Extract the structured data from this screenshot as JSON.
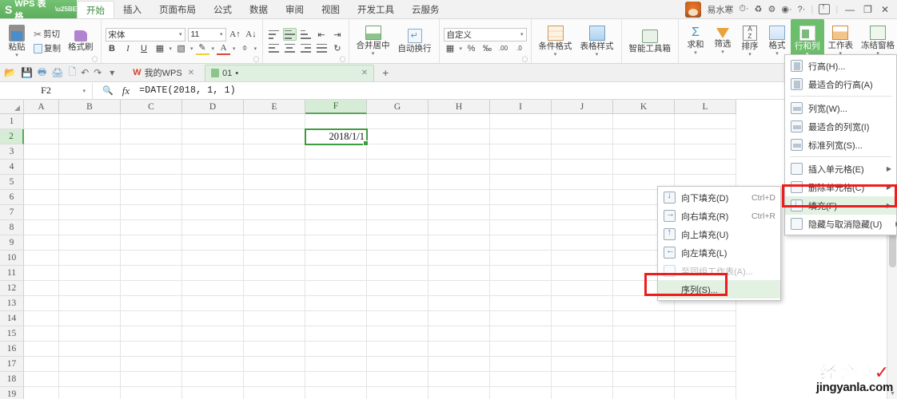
{
  "titlebar": {
    "app_name": "WPS 表格",
    "logo_glyph": "S",
    "tabs": [
      {
        "label": "开始",
        "active": true
      },
      {
        "label": "插入",
        "active": false
      },
      {
        "label": "页面布局",
        "active": false
      },
      {
        "label": "公式",
        "active": false
      },
      {
        "label": "数据",
        "active": false
      },
      {
        "label": "审阅",
        "active": false
      },
      {
        "label": "视图",
        "active": false
      },
      {
        "label": "开发工具",
        "active": false
      },
      {
        "label": "云服务",
        "active": false
      }
    ],
    "user_name": "易水寒",
    "right_icons": [
      "clock-icon",
      "sync-icon",
      "settings-icon",
      "dollar-icon",
      "help-icon",
      "share-box-icon"
    ],
    "minimize": "—",
    "restore": "❐",
    "close": "✕"
  },
  "ribbon": {
    "clipboard": {
      "paste": "粘贴",
      "cut": "剪切",
      "copy": "复制",
      "format_painter": "格式刷"
    },
    "font": {
      "family_value": "宋体",
      "size_value": "11",
      "grow": "A",
      "shrink": "A",
      "bold": "B",
      "italic": "I",
      "underline": "U"
    },
    "alignment": {
      "merge_center": "合并居中",
      "wrap_text": "自动换行"
    },
    "number": {
      "format_value": "自定义",
      "percent": "%",
      "comma": "‰",
      "inc_dec": ".00",
      "dec_dec": ".0"
    },
    "styles": {
      "conditional_format": "条件格式",
      "table_style": "表格样式",
      "smart_toolbox": "智能工具箱"
    },
    "editing": {
      "autosum": "求和",
      "filter": "筛选",
      "sort": "排序",
      "format": "格式",
      "rows_cols": "行和列",
      "worksheet": "工作表",
      "freeze_panes": "冻结窗格"
    }
  },
  "quickbar": {
    "icons": [
      "open-icon",
      "save-icon",
      "print-preview-icon",
      "print-icon",
      "export-pdf-icon",
      "undo-icon",
      "redo-icon",
      "customize-caret-icon"
    ],
    "doc_tabs": [
      {
        "label": "我的WPS",
        "active": false,
        "badge": "W"
      },
      {
        "label": "01",
        "active": true,
        "badge": "doc"
      }
    ],
    "dirty_marker": "•",
    "new_tab": "+"
  },
  "formula_bar": {
    "name_box_value": "F2",
    "search_icon": "search-icon",
    "fx_icon": "fx",
    "formula_value": "=DATE(2018, 1, 1)"
  },
  "sheet": {
    "columns": [
      "A",
      "B",
      "C",
      "D",
      "E",
      "F",
      "G",
      "H",
      "I",
      "J",
      "K",
      "L"
    ],
    "selected_column": "F",
    "rows": [
      "1",
      "2",
      "3",
      "4",
      "5",
      "6",
      "7",
      "8",
      "9",
      "10",
      "11",
      "12",
      "13",
      "14",
      "15",
      "16",
      "17",
      "18",
      "19"
    ],
    "selected_row": "2",
    "selected_cell": "F2",
    "selected_cell_value": "2018/1/1"
  },
  "rows_cols_menu": {
    "items": [
      {
        "label": "行高(H)...",
        "icon": "row-height-icon",
        "arrow": false,
        "selected": false,
        "disabled": false
      },
      {
        "label": "最适合的行高(A)",
        "icon": "best-fit-row-icon",
        "arrow": false,
        "selected": false,
        "disabled": false
      },
      {
        "label": "列宽(W)...",
        "icon": "col-width-icon",
        "arrow": false,
        "selected": false,
        "disabled": false
      },
      {
        "label": "最适合的列宽(I)",
        "icon": "best-fit-col-icon",
        "arrow": false,
        "selected": false,
        "disabled": false
      },
      {
        "label": "标准列宽(S)...",
        "icon": "standard-col-width-icon",
        "arrow": false,
        "selected": false,
        "disabled": false
      },
      {
        "label": "插入单元格(E)",
        "icon": "insert-cells-icon",
        "arrow": true,
        "selected": false,
        "disabled": false
      },
      {
        "label": "删除单元格(C)",
        "icon": "delete-cells-icon",
        "arrow": true,
        "selected": false,
        "disabled": false
      },
      {
        "label": "填充(F)",
        "icon": "fill-icon",
        "arrow": true,
        "selected": true,
        "disabled": false
      },
      {
        "label": "隐藏与取消隐藏(U)",
        "icon": "hide-unhide-icon",
        "arrow": true,
        "selected": false,
        "disabled": false
      }
    ],
    "highlighted_label": "填充(F)"
  },
  "fill_submenu": {
    "items": [
      {
        "label": "向下填充(D)",
        "shortcut": "Ctrl+D",
        "icon": "fill-down-icon",
        "selected": false,
        "disabled": false
      },
      {
        "label": "向右填充(R)",
        "shortcut": "Ctrl+R",
        "icon": "fill-right-icon",
        "selected": false,
        "disabled": false
      },
      {
        "label": "向上填充(U)",
        "shortcut": "",
        "icon": "fill-up-icon",
        "selected": false,
        "disabled": false
      },
      {
        "label": "向左填充(L)",
        "shortcut": "",
        "icon": "fill-left-icon",
        "selected": false,
        "disabled": false
      },
      {
        "label": "至同组工作表(A)...",
        "shortcut": "",
        "icon": "across-sheets-icon",
        "selected": false,
        "disabled": true
      },
      {
        "label": "序列(S)...",
        "shortcut": "",
        "icon": "series-icon",
        "selected": true,
        "disabled": false
      }
    ],
    "highlighted_label": "序列(S)..."
  },
  "watermark": {
    "cn_text": "经验啦",
    "check": "✓",
    "en_text": "jingyanla.com",
    "check_color": "#e22020"
  },
  "colors": {
    "brand_green": "#5cae5c",
    "highlight_green": "#6cbe6c",
    "menu_select": "#e2f1e2",
    "annotation_red": "#ee1c1c",
    "selection_border": "#3f9b3f"
  }
}
